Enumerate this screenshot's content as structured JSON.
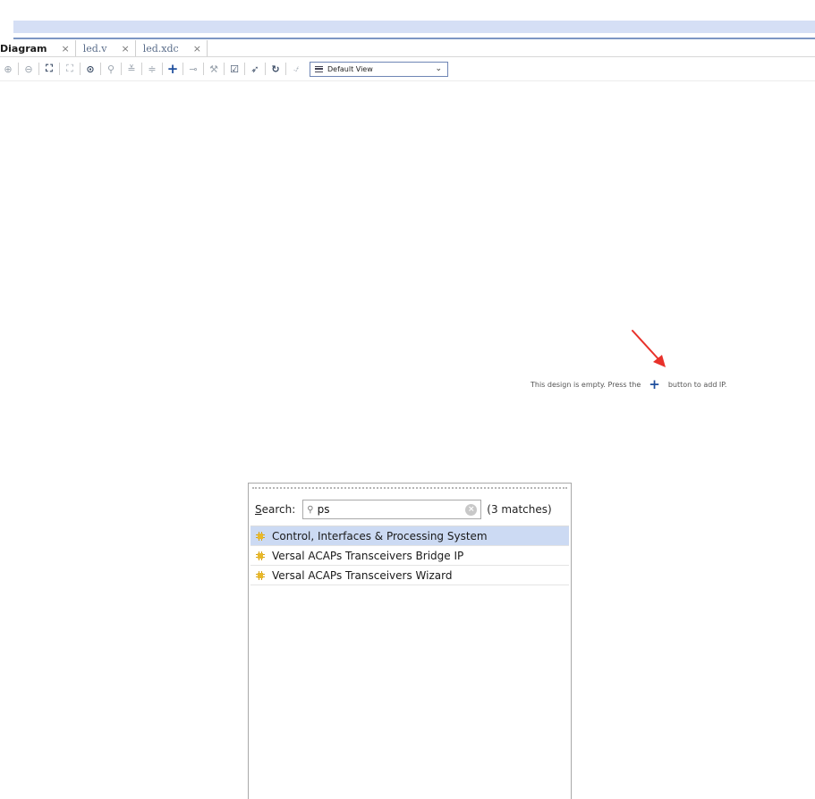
{
  "tabs": [
    {
      "label": "Diagram",
      "close": "×",
      "active": true
    },
    {
      "label": "led.v",
      "close": "×",
      "active": false
    },
    {
      "label": "led.xdc",
      "close": "×",
      "active": false
    }
  ],
  "toolbar": {
    "icons": {
      "zoom_in": "⊕",
      "zoom_out": "⊖",
      "fit_full": "⛶",
      "fit_selection": "⛶",
      "autoconnect": "⊙",
      "search": "⚲",
      "collapse": "≚",
      "expand": "≑",
      "add_ip": "+",
      "make_connection": "⊸",
      "customize": "⚒",
      "validate": "☑",
      "pin": "➶",
      "regenerate": "↻",
      "drc": "⍻"
    },
    "view_select": {
      "value": "Default View",
      "chevron": "⌄"
    }
  },
  "canvas": {
    "hint_before": "This design is empty. Press the",
    "hint_plus": "+",
    "hint_after": "button to add IP.",
    "arrow_color": "#e8312a"
  },
  "ip_popup": {
    "search_label_underlined": "S",
    "search_label_rest": "earch:",
    "search_icon": "⚲",
    "search_value": "ps",
    "clear_icon": "×",
    "matches": "(3 matches)",
    "results": [
      {
        "label": "Control, Interfaces & Processing System",
        "selected": true
      },
      {
        "label": "Versal ACAPs Transceivers Bridge IP",
        "selected": false
      },
      {
        "label": "Versal ACAPs Transceivers Wizard",
        "selected": false
      }
    ]
  },
  "colors": {
    "accent": "#1f4f9e",
    "selection": "#ccdaf3",
    "ip_icon": "#e8b829"
  }
}
